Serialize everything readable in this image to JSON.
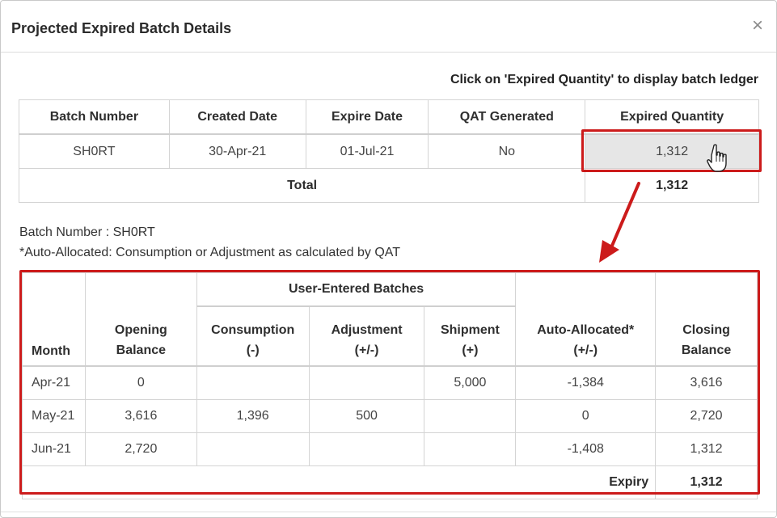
{
  "modal": {
    "title": "Projected Expired Batch Details",
    "close_label": "×",
    "hint": "Click on 'Expired Quantity' to display batch ledger"
  },
  "batch_table": {
    "headers": [
      "Batch Number",
      "Created Date",
      "Expire Date",
      "QAT Generated",
      "Expired Quantity"
    ],
    "rows": [
      [
        "SH0RT",
        "30-Apr-21",
        "01-Jul-21",
        "No",
        "1,312"
      ]
    ],
    "total_label": "Total",
    "total_value": "1,312"
  },
  "ledger_info": {
    "batch_line": "Batch Number : SH0RT",
    "note": "*Auto-Allocated: Consumption or Adjustment as calculated by QAT"
  },
  "ledger_table": {
    "group_header": "User-Entered Batches",
    "headers": {
      "month": "Month",
      "opening_1": "Opening",
      "opening_2": "Balance",
      "consumption_1": "Consumption",
      "consumption_2": "(-)",
      "adjustment_1": "Adjustment",
      "adjustment_2": "(+/-)",
      "shipment_1": "Shipment",
      "shipment_2": "(+)",
      "auto_1": "Auto-Allocated*",
      "auto_2": "(+/-)",
      "closing_1": "Closing",
      "closing_2": "Balance"
    },
    "rows": [
      [
        "Apr-21",
        "0",
        "",
        "",
        "5,000",
        "-1,384",
        "3,616"
      ],
      [
        "May-21",
        "3,616",
        "1,396",
        "500",
        "",
        "0",
        "2,720"
      ],
      [
        "Jun-21",
        "2,720",
        "",
        "",
        "",
        "-1,408",
        "1,312"
      ]
    ],
    "expiry_label": "Expiry",
    "expiry_value": "1,312"
  },
  "colors": {
    "annotation_red": "#cc1b1b",
    "highlight_cell": "#e6e6e6"
  },
  "icons": [
    "close-icon",
    "hand-cursor-icon",
    "annotation-arrow-icon"
  ]
}
